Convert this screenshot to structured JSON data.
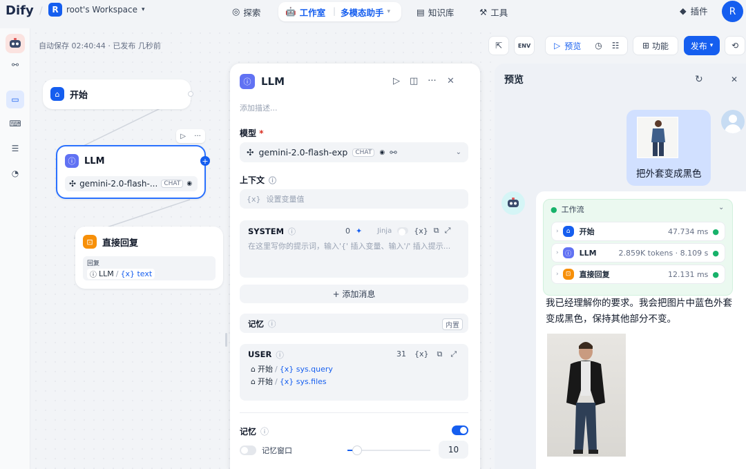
{
  "topbar": {
    "logo_text": "Dify",
    "workspace_initial": "R",
    "workspace_name": "root's Workspace",
    "nav_explore": "探索",
    "nav_studio": "工作室",
    "nav_app": "多模态助手",
    "nav_knowledge": "知识库",
    "nav_tools": "工具",
    "plugins": "插件",
    "user_initial": "R"
  },
  "toolbar": {
    "autosave": "自动保存 02:40:44 · 已发布 几秒前",
    "env_label": "ENV",
    "preview_label": "预览",
    "features_label": "功能",
    "publish_label": "发布"
  },
  "canvas": {
    "start_node": "开始",
    "llm_node": "LLM",
    "llm_model": "gemini-2.0-flash-...",
    "chat_badge": "CHAT",
    "answer_node": "直接回复",
    "answer_label": "回复",
    "answer_ref_node": "LLM",
    "answer_ref_var": "{x} text"
  },
  "panel": {
    "title": "LLM",
    "desc_placeholder": "添加描述...",
    "model_label": "模型",
    "model_required": "*",
    "model_name": "gemini-2.0-flash-exp",
    "chat_badge": "CHAT",
    "context_label": "上下文",
    "context_placeholder": "设置变量值",
    "context_prefix": "{x}",
    "system_label": "SYSTEM",
    "system_count": "0",
    "jinja_label": "Jinja",
    "var_icon": "{x}",
    "system_placeholder": "在这里写你的提示词，输入'{' 插入变量、输入'/' 插入提示...",
    "add_message": "+ 添加消息",
    "memory_label": "记忆",
    "builtin_label": "内置",
    "user_label": "USER",
    "user_count": "31",
    "user_var1_node": "开始",
    "user_var1": "{x} sys.query",
    "user_var2_node": "开始",
    "user_var2": "{x} sys.files",
    "memory2_label": "记忆",
    "memory_window_label": "记忆窗口",
    "memory_window_value": "10"
  },
  "preview": {
    "title": "预览",
    "user_message": "把外套变成黑色",
    "workflow_label": "工作流",
    "steps": [
      {
        "name": "开始",
        "meta": "47.734 ms"
      },
      {
        "name": "LLM",
        "meta": "2.859K tokens · 8.109 s"
      },
      {
        "name": "直接回复",
        "meta": "12.131 ms"
      }
    ],
    "answer": "我已经理解你的要求。我会把图片中蓝色外套变成黑色，保持其他部分不变。"
  },
  "colors": {
    "accent": "#155eef",
    "success": "#17b26a",
    "answer_icon": "#f79009"
  }
}
